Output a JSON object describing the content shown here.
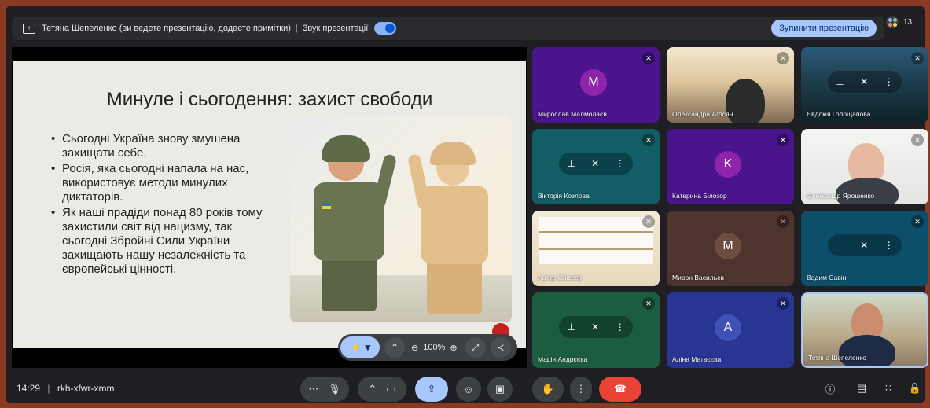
{
  "banner": {
    "presenter_text": "Тетяна Шепеленко (ви ведете презентацію, додаєте примітки)",
    "separator": "|",
    "sound_label": "Звук презентації",
    "stop_button": "Зупинити презентацію",
    "people_count": "13"
  },
  "slide": {
    "title": "Минуле і сьогодення: захист свободи",
    "bullets": [
      "Сьогодні Україна знову змушена захищати себе.",
      "Росія, яка сьогодні напала на нас, використовує методи минулих диктаторів.",
      "Як наші прадіди понад 80 років тому захистили світ від нацизму, так сьогодні Збройні Сили України захищають нашу незалежність та європейські цінності."
    ]
  },
  "zoom_toolbar": {
    "pen_glyph": "⚡",
    "zoom_level": "100%"
  },
  "participants": [
    {
      "name": "Мирослав Малмолаєв",
      "initial": "M",
      "color": "#8e24aa"
    },
    {
      "name": "Олександра Агосян"
    },
    {
      "name": "Євдокія Голощапова"
    },
    {
      "name": "Вікторія Козлова"
    },
    {
      "name": "Катерина Білозор",
      "initial": "K",
      "color": "#8e24aa"
    },
    {
      "name": "Олександр Ярошенко"
    },
    {
      "name": "Артур Єлісєєв"
    },
    {
      "name": "Мирон Васильєв",
      "initial": "M",
      "color": "#6d4c41"
    },
    {
      "name": "Вадим Савін"
    },
    {
      "name": "Марія Андрєєва"
    },
    {
      "name": "Аліна Матвєєва",
      "initial": "A",
      "color": "#3f51b5"
    },
    {
      "name": "Тетяна Шепеленко"
    }
  ],
  "bottom_bar": {
    "time": "14:29",
    "separator": "|",
    "meeting_code": "rkh-xfwr-xmm"
  },
  "colors": {
    "accent": "#a8c7fa",
    "end_call": "#ea4335",
    "surface": "#1f1f23"
  }
}
